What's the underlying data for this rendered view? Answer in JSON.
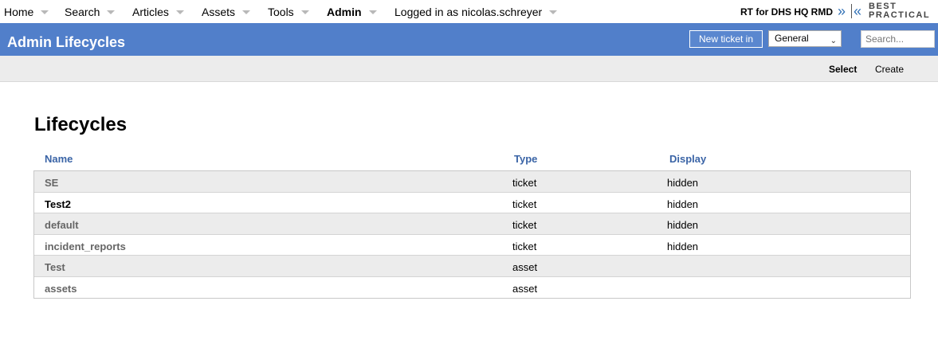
{
  "topmenu": {
    "items": [
      {
        "label": "Home"
      },
      {
        "label": "Search"
      },
      {
        "label": "Articles"
      },
      {
        "label": "Assets"
      },
      {
        "label": "Tools"
      },
      {
        "label": "Admin"
      },
      {
        "label": "Logged in as nicolas.schreyer"
      }
    ],
    "rt_name": "RT for DHS HQ RMD",
    "logo_line1": "BEST",
    "logo_line2": "PRACTICAL"
  },
  "header": {
    "title": "Admin Lifecycles",
    "new_ticket_label": "New ticket in",
    "queue_selected": "General",
    "search_placeholder": "Search..."
  },
  "pagemenu": {
    "select_label": "Select",
    "create_label": "Create"
  },
  "main": {
    "heading": "Lifecycles",
    "columns": {
      "name": "Name",
      "type": "Type",
      "display": "Display"
    },
    "rows": [
      {
        "name": "SE",
        "type": "ticket",
        "display": "hidden"
      },
      {
        "name": "Test2",
        "type": "ticket",
        "display": "hidden"
      },
      {
        "name": "default",
        "type": "ticket",
        "display": "hidden"
      },
      {
        "name": "incident_reports",
        "type": "ticket",
        "display": "hidden"
      },
      {
        "name": "Test",
        "type": "asset",
        "display": ""
      },
      {
        "name": "assets",
        "type": "asset",
        "display": ""
      }
    ]
  },
  "colors": {
    "header_bg": "#517fca",
    "column_header": "#3a64a6",
    "logo_blue": "#2f6fb5"
  }
}
